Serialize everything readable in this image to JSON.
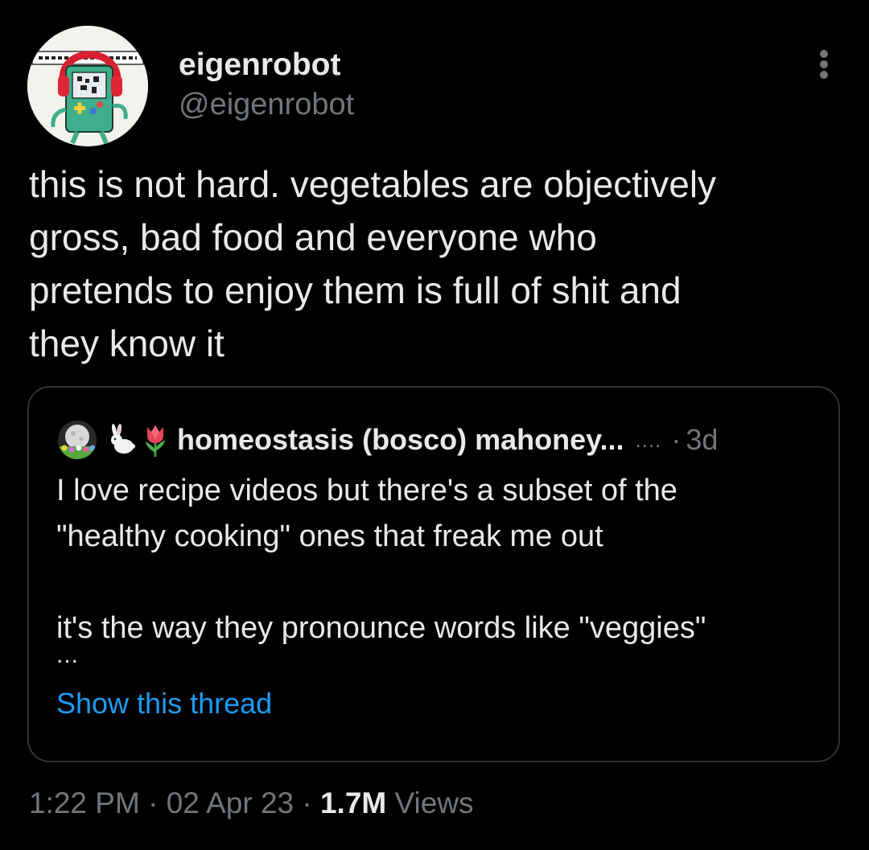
{
  "tweet": {
    "author": {
      "display_name": "eigenrobot",
      "handle": "@eigenrobot",
      "avatar_icon": "robot-with-headphones-avatar"
    },
    "more_icon": "more-options-icon",
    "text": "this is not hard. vegetables are objectively\ngross, bad food and everyone who\npretends to enjoy them is full of shit and\nthey know it",
    "quote": {
      "avatar_icon": "moon-flowers-avatar",
      "name_emojis": [
        "rabbit-emoji",
        "tulip-emoji"
      ],
      "author_name": "homeostasis (bosco) mahoney...",
      "verified_mark": "....",
      "separator": "·",
      "time": "3d",
      "text": "I love recipe videos but there's a subset of the\n\"healthy cooking\" ones that freak me out\n\nit's the way they pronounce words like \"veggies\"",
      "ellipsis": "...",
      "show_thread_label": "Show this thread"
    },
    "meta": {
      "time": "1:22 PM",
      "separator": "·",
      "date": "02 Apr 23",
      "views_count": "1.7M",
      "views_label": "Views"
    }
  },
  "colors": {
    "background": "#000000",
    "text_primary": "#e7e9ea",
    "text_secondary": "#71767b",
    "link": "#1d9bf0",
    "border": "#2f3336"
  }
}
